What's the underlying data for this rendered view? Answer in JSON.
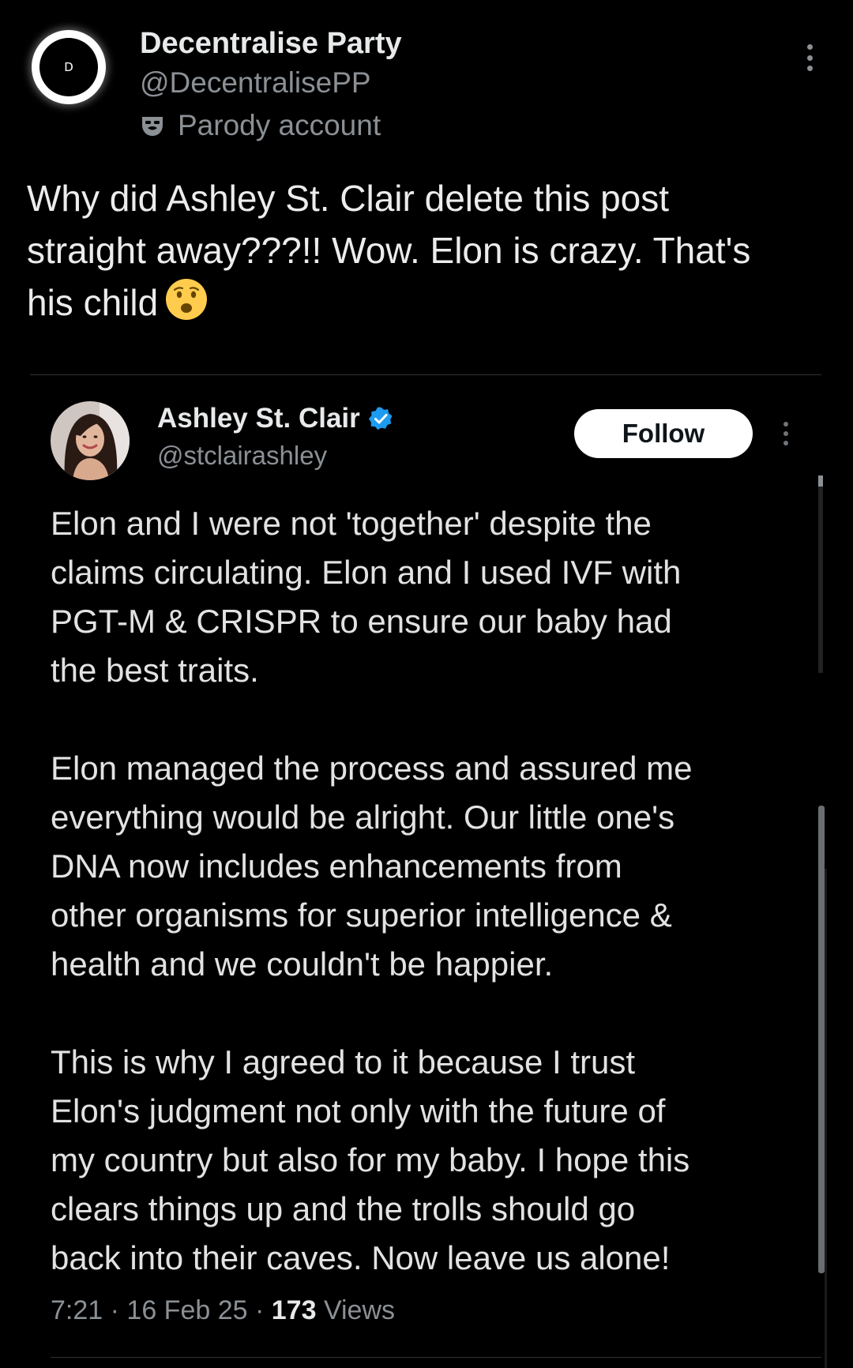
{
  "outer_post": {
    "avatar_letter": "D",
    "display_name": "Decentralise Party",
    "handle": "@DecentralisePP",
    "parody_label": "Parody account",
    "parody_icon": "theater-mask-icon",
    "text": "Why did Ashley St. Clair delete this post\nstraight away???!! Wow. Elon is crazy. That's\nhis child",
    "emoji": "frowning-face-open-mouth-icon"
  },
  "quoted_post": {
    "display_name": "Ashley St. Clair",
    "handle": "@stclairashley",
    "verified_icon": "verified-badge-icon",
    "follow_label": "Follow",
    "paragraphs": [
      "Elon and I were not 'together' despite the\nclaims circulating. Elon and I used IVF with\nPGT-M & CRISPR to ensure our baby had\nthe best traits.",
      "Elon managed the process and assured me\neverything would be alright. Our little one's\nDNA now includes enhancements from\nother organisms for superior intelligence &\nhealth and we couldn't be happier.",
      "This is why I agreed to it because I trust\nElon's judgment not only with the future of\nmy country but also for my baby. I hope this\nclears things up and the trolls should go\nback into their caves. Now leave us alone!"
    ],
    "time": "7:21",
    "date": "16 Feb 25",
    "views_count": "173",
    "views_label": "Views",
    "separator": " · "
  },
  "colors": {
    "background": "#000000",
    "primary_text": "#e7e9ea",
    "secondary_text": "#8b9095",
    "verified_blue": "#1d9bf0",
    "emoji_yellow": "#ffcc4d"
  }
}
